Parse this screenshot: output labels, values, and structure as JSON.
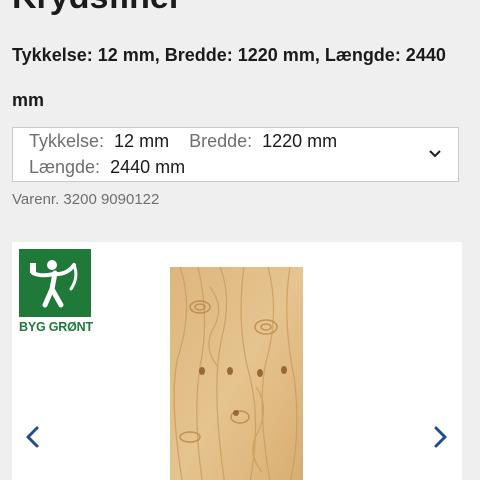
{
  "product": {
    "title_fragment": "Krydsfiner",
    "subtitle": "Tykkelse: 12 mm, Bredde: 1220 mm, Længde: 2440 mm",
    "item_number": "Varenr. 3200 9090122"
  },
  "variant_selector": {
    "thickness_label": "Tykkelse:",
    "thickness_value": "12 mm",
    "width_label": "Bredde:",
    "width_value": "1220 mm",
    "length_label": "Længde:",
    "length_value": "2440 mm",
    "icon": "chevron-down-icon"
  },
  "gallery": {
    "badge_text": "BYG GRØNT",
    "badge_color": "#1f7a3a",
    "prev_icon": "chevron-left-icon",
    "next_icon": "chevron-right-icon",
    "arrow_color": "#1f4e8c"
  }
}
